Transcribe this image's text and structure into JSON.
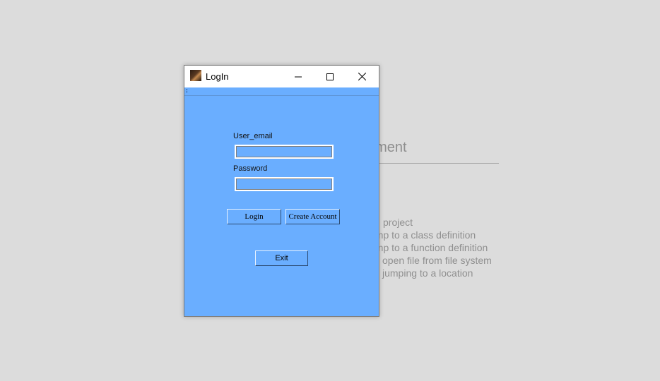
{
  "background": {
    "heading": "ument",
    "subtext": ")",
    "items": [
      "project",
      "ump to a class definition",
      "ump to a function definition",
      "open file from file system",
      "jumping to a location"
    ]
  },
  "window": {
    "title": "LogIn",
    "controls": {
      "minimize_icon": "minimize-icon",
      "maximize_icon": "maximize-icon",
      "close_icon": "close-icon"
    }
  },
  "form": {
    "email_label": "User_email",
    "email_value": "",
    "password_label": "Password",
    "password_value": ""
  },
  "buttons": {
    "login": "Login",
    "create_account": "Create Account",
    "exit": "Exit"
  },
  "colors": {
    "dialog_background": "#6aaeff",
    "desktop_background": "#dcdcdc"
  }
}
